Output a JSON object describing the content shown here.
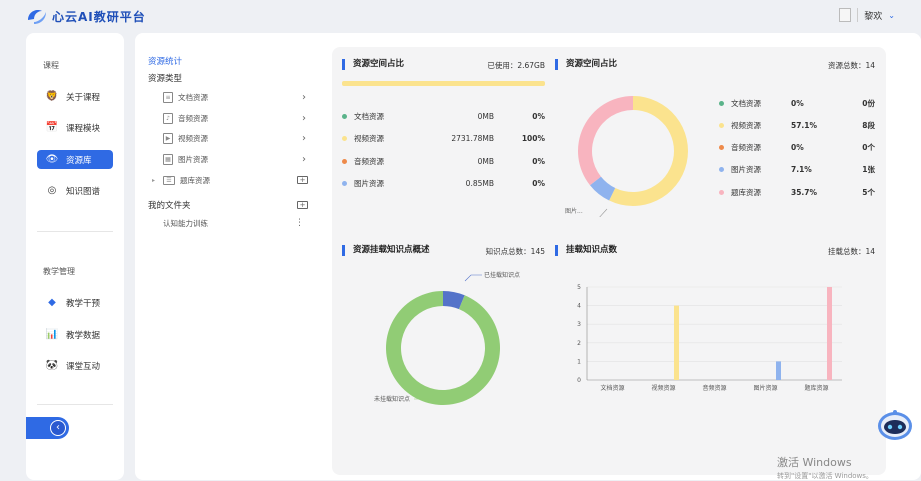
{
  "app": {
    "name": "心云AI教研平台"
  },
  "user": {
    "name": "黎欢"
  },
  "sidebar": {
    "section1": "课程",
    "items1": [
      {
        "label": "关于课程",
        "icon": "lion-icon"
      },
      {
        "label": "课程模块",
        "icon": "calendar-icon"
      },
      {
        "label": "资源库",
        "icon": "eye-icon",
        "active": true
      },
      {
        "label": "知识图谱",
        "icon": "target-icon"
      }
    ],
    "section2": "教学管理",
    "items2": [
      {
        "label": "教学干预",
        "icon": "layers-icon"
      },
      {
        "label": "教学数据",
        "icon": "chart-icon"
      },
      {
        "label": "课堂互动",
        "icon": "panda-icon"
      }
    ]
  },
  "tree": {
    "stats_link": "资源统计",
    "type_heading": "资源类型",
    "types": [
      "文档资源",
      "音频资源",
      "视频资源",
      "图片资源",
      "题库资源"
    ],
    "my_folder": "我的文件夹",
    "folders": [
      "认知能力训练"
    ]
  },
  "storage_bar": {
    "title": "资源空间占比",
    "used_label": "已使用：2.67GB",
    "rows": [
      {
        "name": "文档资源",
        "size": "0MB",
        "pct": "0%",
        "color": "#5ab38a"
      },
      {
        "name": "视频资源",
        "size": "2731.78MB",
        "pct": "100%",
        "color": "#fbe38e"
      },
      {
        "name": "音频资源",
        "size": "0MB",
        "pct": "0%",
        "color": "#ee8a4a"
      },
      {
        "name": "图片资源",
        "size": "0.85MB",
        "pct": "0%",
        "color": "#8fb3ee"
      }
    ]
  },
  "storage_ring": {
    "title": "资源空间占比",
    "total_label": "资源总数：14",
    "callout": "图片...",
    "rows": [
      {
        "name": "文档资源",
        "pct": "0%",
        "count": "0份",
        "color": "#5ab38a",
        "value": 0
      },
      {
        "name": "视频资源",
        "pct": "57.1%",
        "count": "8段",
        "color": "#fbe38e",
        "value": 8
      },
      {
        "name": "音频资源",
        "pct": "0%",
        "count": "0个",
        "color": "#ee8a4a",
        "value": 0
      },
      {
        "name": "图片资源",
        "pct": "7.1%",
        "count": "1张",
        "color": "#8fb3ee",
        "value": 1
      },
      {
        "name": "题库资源",
        "pct": "35.7%",
        "count": "5个",
        "color": "#f8b4bf",
        "value": 5
      }
    ]
  },
  "knowledge_ring": {
    "title": "资源挂载知识点概述",
    "total_label": "知识点总数：145",
    "mounted_label": "已挂载知识点",
    "unmounted_label": "未挂载知识点",
    "mounted_color": "#5473c9",
    "unmounted_color": "#91cc75",
    "mounted": 9,
    "unmounted": 136
  },
  "chart_data": {
    "type": "bar",
    "title": "挂载知识点数",
    "meta": "挂载总数：14",
    "categories": [
      "文档资源",
      "视频资源",
      "音频资源",
      "图片资源",
      "题库资源"
    ],
    "values": [
      0,
      4,
      0,
      1,
      5
    ],
    "colors": [
      "#5ab38a",
      "#fbe38e",
      "#ee8a4a",
      "#8fb3ee",
      "#f8b4bf"
    ],
    "ylim": [
      0,
      5
    ],
    "yticks": [
      "0",
      "1",
      "2",
      "3",
      "4",
      "5"
    ]
  },
  "watermark": {
    "line1": "激活 Windows",
    "line2": "转到\"设置\"以激活 Windows。"
  }
}
